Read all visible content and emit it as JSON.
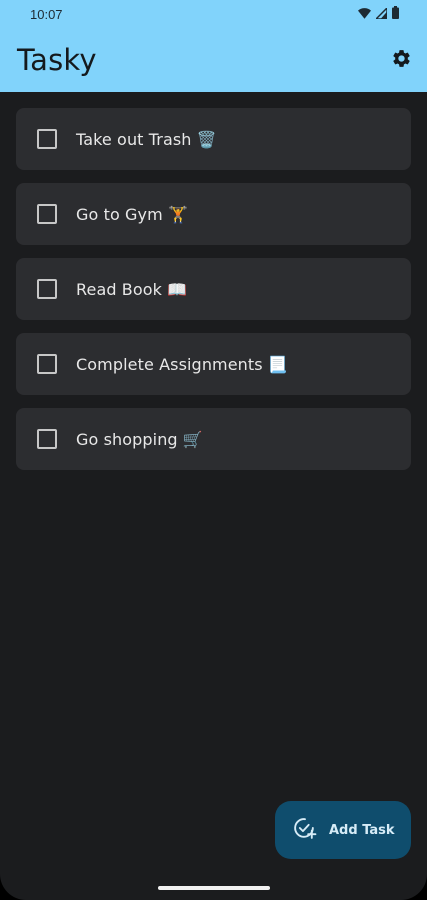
{
  "status_bar": {
    "time": "10:07",
    "icons": [
      "wifi-icon",
      "signal-icon",
      "battery-icon"
    ]
  },
  "app_bar": {
    "title": "Tasky",
    "settings_icon": "gear-icon"
  },
  "tasks": [
    {
      "label": "Take out Trash 🗑️",
      "checked": false
    },
    {
      "label": "Go to Gym 🏋️",
      "checked": false
    },
    {
      "label": "Read Book 📖",
      "checked": false
    },
    {
      "label": "Complete Assignments 📃",
      "checked": false
    },
    {
      "label": "Go shopping 🛒",
      "checked": false
    }
  ],
  "fab": {
    "label": "Add Task",
    "icon": "task-add-icon"
  },
  "colors": {
    "app_bar": "#81d3fb",
    "background": "#1b1c1e",
    "card": "#2c2d30",
    "fab": "#0f4d6d"
  }
}
